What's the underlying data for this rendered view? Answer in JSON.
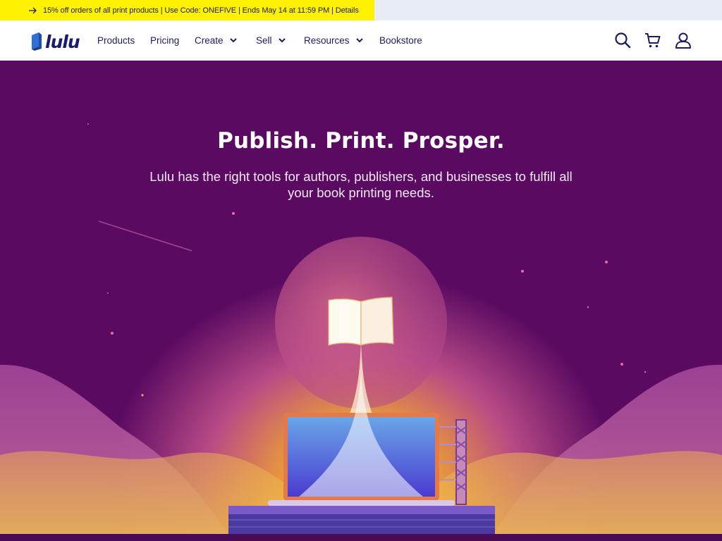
{
  "promo": {
    "text": "15% off orders of all print products | Use Code: ONEFIVE | Ends May 14 at 11:59 PM | Details",
    "icon": "arrow-right-icon",
    "bg_color": "#fff200"
  },
  "nav": {
    "logo_text": "lulu",
    "items": [
      {
        "label": "Products",
        "has_dropdown": false
      },
      {
        "label": "Pricing",
        "has_dropdown": false
      },
      {
        "label": "Create",
        "has_dropdown": true
      },
      {
        "label": "Sell",
        "has_dropdown": true
      },
      {
        "label": "Resources",
        "has_dropdown": true
      },
      {
        "label": "Bookstore",
        "has_dropdown": false
      }
    ],
    "icons": [
      "search-icon",
      "cart-icon",
      "account-icon"
    ]
  },
  "hero": {
    "title": "Publish. Print. Prosper.",
    "subtitle": "Lulu has the right tools for authors, publishers, and businesses to fulfill all your book printing needs.",
    "bg_color": "#5b0a62",
    "glow_color": "#f5c72a"
  },
  "colors": {
    "brand_navy": "#1b1b5f",
    "logo_blue": "#2f6fd6"
  }
}
